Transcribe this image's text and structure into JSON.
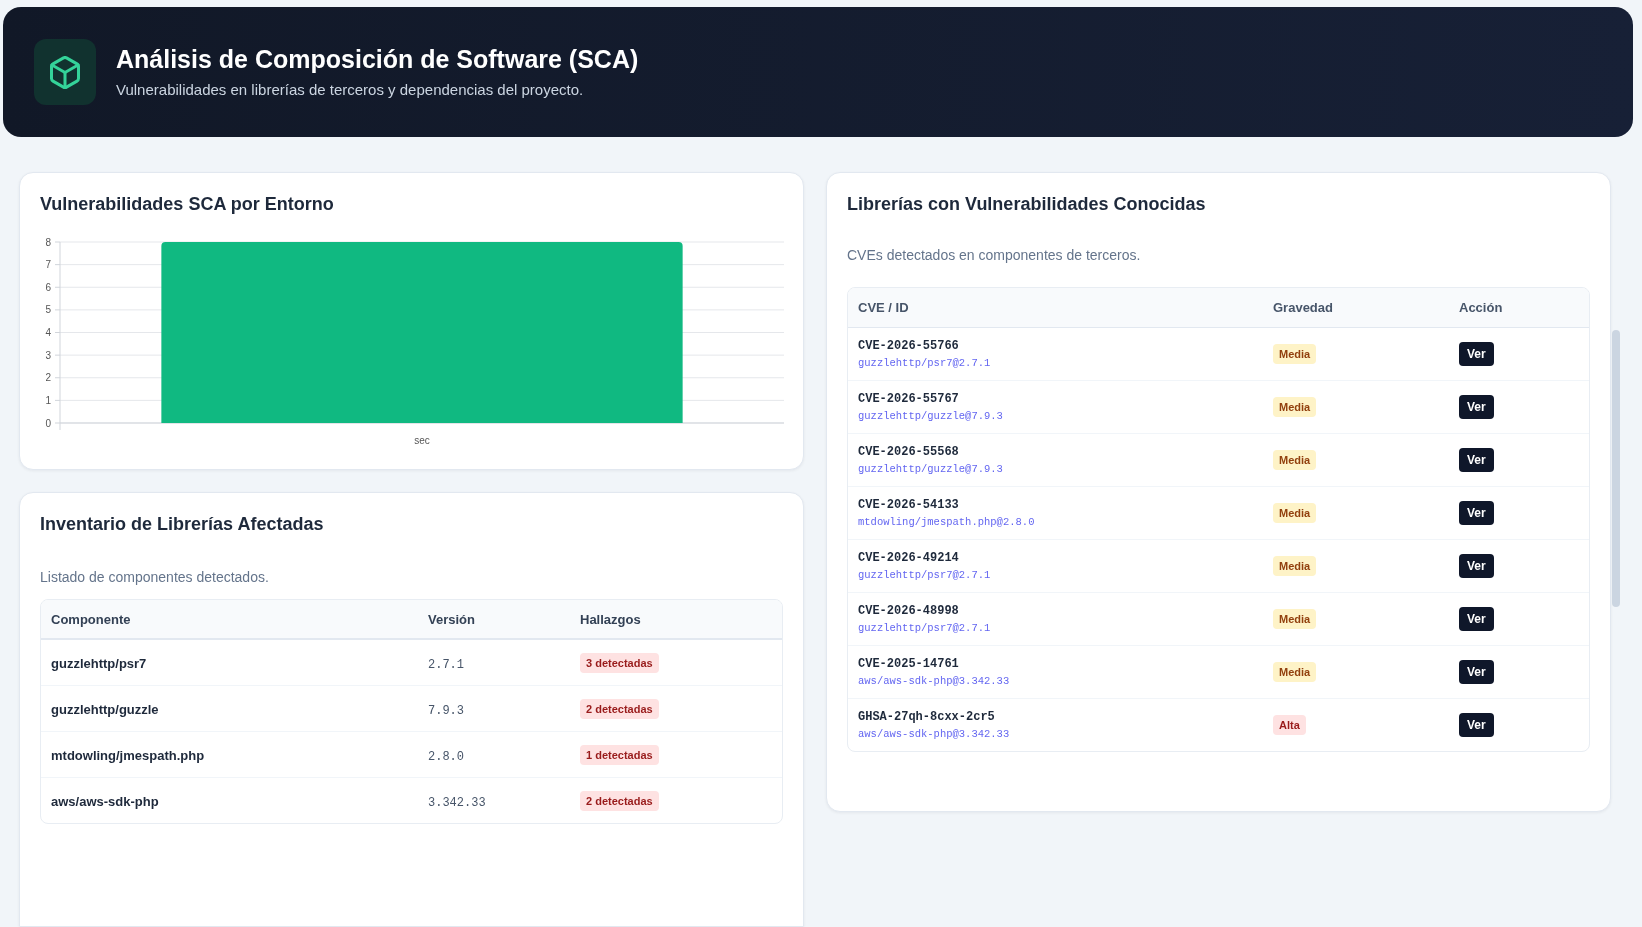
{
  "header": {
    "title": "Análisis de Composición de Software (SCA)",
    "subtitle": "Vulnerabilidades en librerías de terceros y dependencias del proyecto."
  },
  "chart_card": {
    "title": "Vulnerabilidades SCA por Entorno",
    "chart_data": {
      "type": "bar",
      "categories": [
        "sec"
      ],
      "values": [
        8
      ],
      "ylim": [
        0,
        8
      ],
      "yticks": [
        0,
        1,
        2,
        3,
        4,
        5,
        6,
        7,
        8
      ],
      "grid": true
    }
  },
  "inventory": {
    "title": "Inventario de Librerías Afectadas",
    "subtitle": "Listado de componentes detectados.",
    "columns": [
      "Componente",
      "Versión",
      "Hallazgos"
    ],
    "rows": [
      {
        "component": "guzzlehttp/psr7",
        "version": "2.7.1",
        "findings": "3 detectadas"
      },
      {
        "component": "guzzlehttp/guzzle",
        "version": "7.9.3",
        "findings": "2 detectadas"
      },
      {
        "component": "mtdowling/jmespath.php",
        "version": "2.8.0",
        "findings": "1 detectadas"
      },
      {
        "component": "aws/aws-sdk-php",
        "version": "3.342.33",
        "findings": "2 detectadas"
      }
    ]
  },
  "vulnerabilities": {
    "title": "Librerías con Vulnerabilidades Conocidas",
    "subtitle": "CVEs detectados en componentes de terceros.",
    "columns": [
      "CVE / ID",
      "Gravedad",
      "Acción"
    ],
    "rows": [
      {
        "id": "CVE-2026-55766",
        "package": "guzzlehttp/psr7@2.7.1",
        "severity": "Media",
        "kind": "medium",
        "action": "Ver"
      },
      {
        "id": "CVE-2026-55767",
        "package": "guzzlehttp/guzzle@7.9.3",
        "severity": "Media",
        "kind": "medium",
        "action": "Ver"
      },
      {
        "id": "CVE-2026-55568",
        "package": "guzzlehttp/guzzle@7.9.3",
        "severity": "Media",
        "kind": "medium",
        "action": "Ver"
      },
      {
        "id": "CVE-2026-54133",
        "package": "mtdowling/jmespath.php@2.8.0",
        "severity": "Media",
        "kind": "medium",
        "action": "Ver"
      },
      {
        "id": "CVE-2026-49214",
        "package": "guzzlehttp/psr7@2.7.1",
        "severity": "Media",
        "kind": "medium",
        "action": "Ver"
      },
      {
        "id": "CVE-2026-48998",
        "package": "guzzlehttp/psr7@2.7.1",
        "severity": "Media",
        "kind": "medium",
        "action": "Ver"
      },
      {
        "id": "CVE-2025-14761",
        "package": "aws/aws-sdk-php@3.342.33",
        "severity": "Media",
        "kind": "medium",
        "action": "Ver"
      },
      {
        "id": "GHSA-27qh-8cxx-2cr5",
        "package": "aws/aws-sdk-php@3.342.33",
        "severity": "Alta",
        "kind": "high",
        "action": "Ver"
      }
    ]
  }
}
